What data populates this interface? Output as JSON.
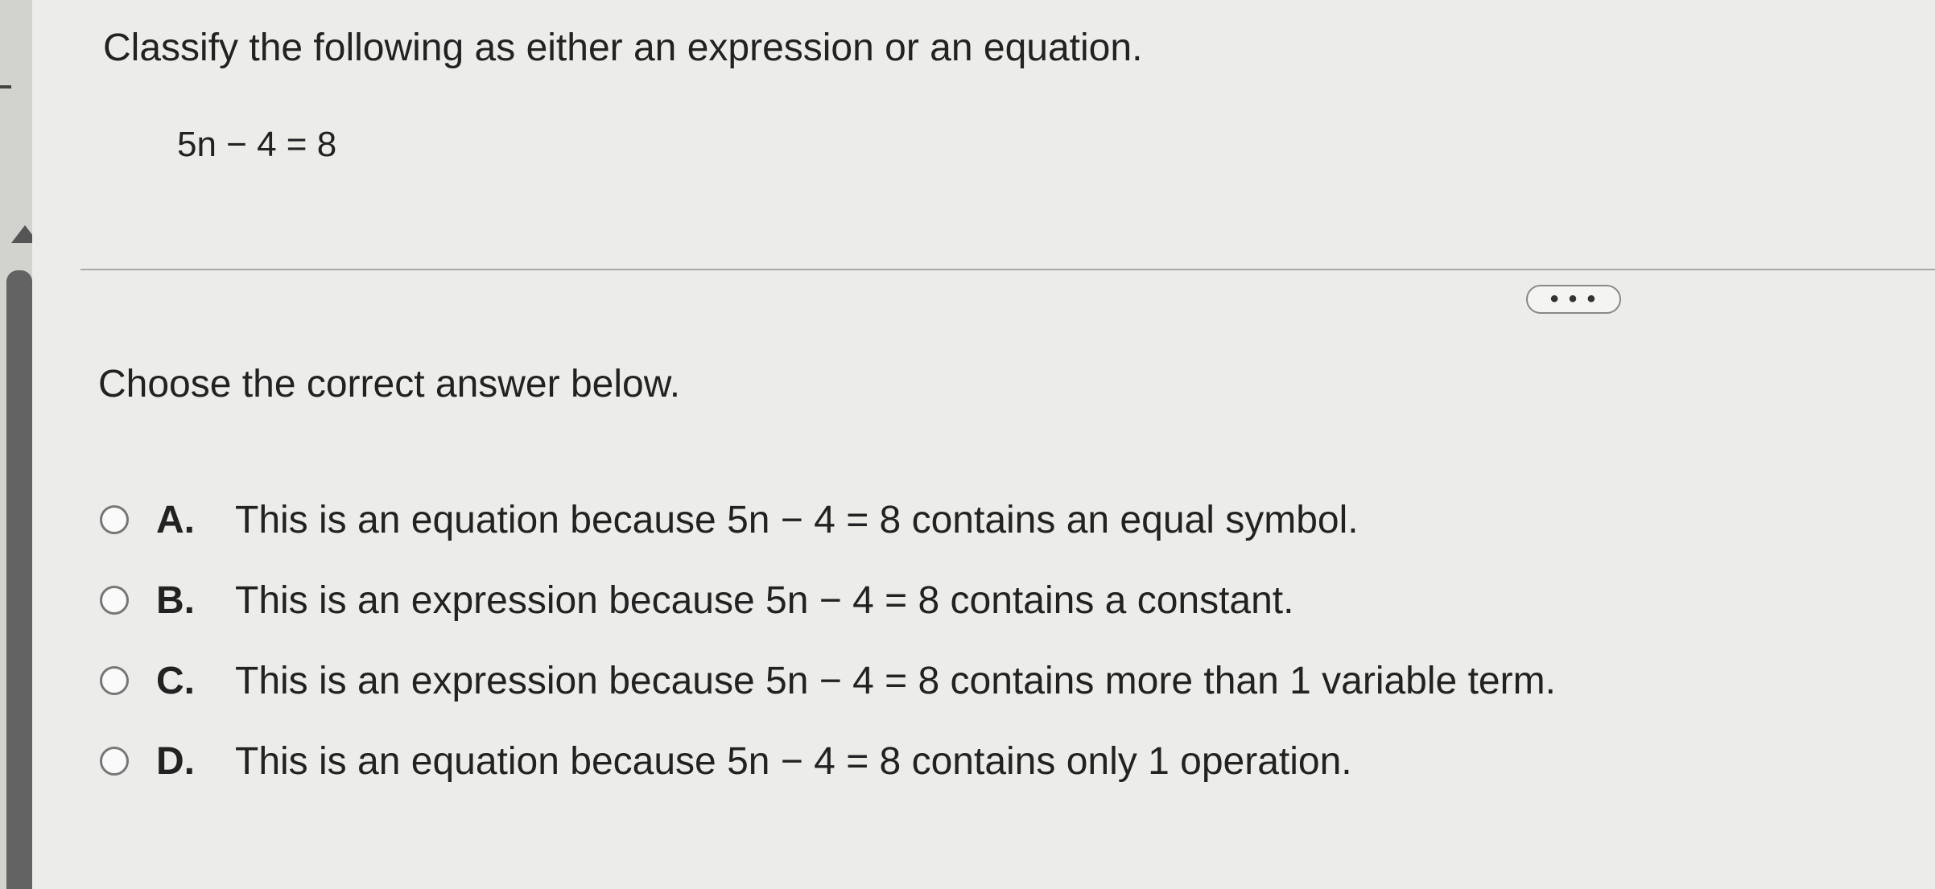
{
  "header": {
    "question": "Classify the following as either an expression or an equation.",
    "equation": "5n − 4 = 8"
  },
  "more_button": {
    "label": "• • •"
  },
  "prompt": "Choose the correct answer below.",
  "options": [
    {
      "letter": "A.",
      "text": "This is an equation because 5n − 4 = 8 contains an equal symbol."
    },
    {
      "letter": "B.",
      "text": "This is an expression because 5n − 4 = 8 contains a constant."
    },
    {
      "letter": "C.",
      "text": "This is an expression because 5n − 4 = 8 contains more than 1 variable term."
    },
    {
      "letter": "D.",
      "text": "This is an equation because 5n − 4 = 8 contains only 1 operation."
    }
  ],
  "colors": {
    "top_bar": "#4a5591",
    "scroll_thumb": "#636363"
  }
}
